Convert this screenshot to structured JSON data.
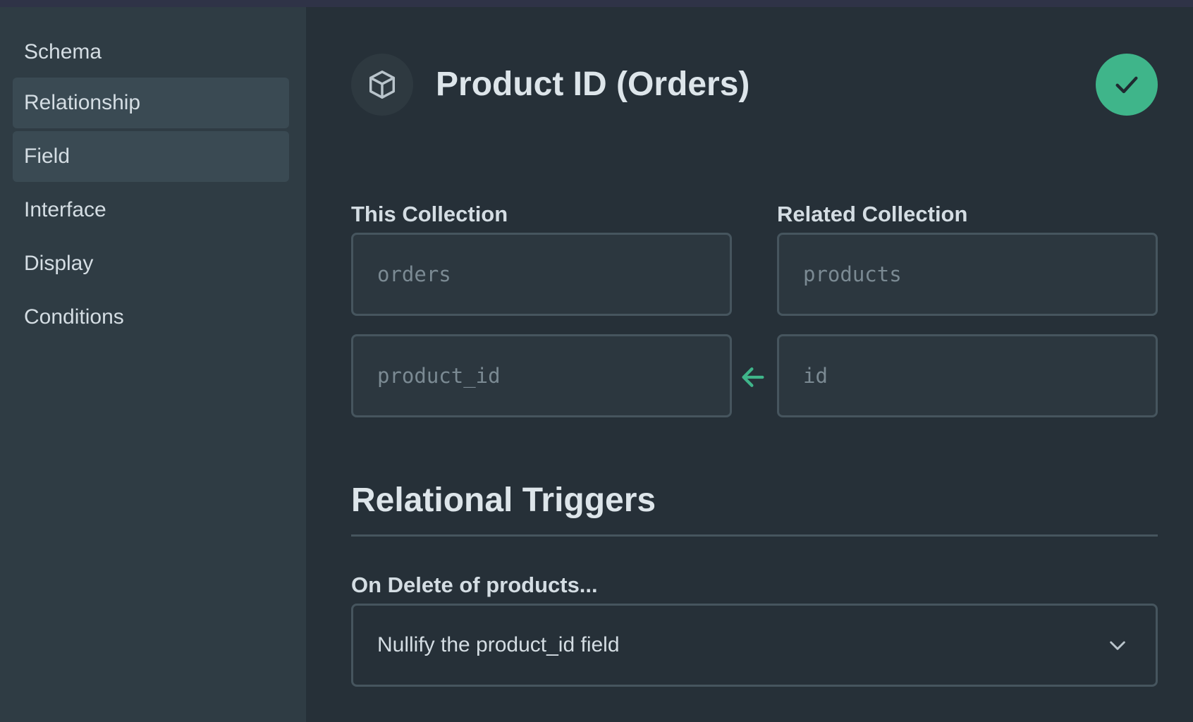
{
  "sidebar": {
    "items": [
      {
        "label": "Schema",
        "active": false
      },
      {
        "label": "Relationship",
        "active": true
      },
      {
        "label": "Field",
        "active": true
      },
      {
        "label": "Interface",
        "active": false
      },
      {
        "label": "Display",
        "active": false
      },
      {
        "label": "Conditions",
        "active": false
      }
    ]
  },
  "header": {
    "title": "Product ID (Orders)",
    "icon": "cube-icon",
    "save_icon": "check-icon"
  },
  "relationship": {
    "this_collection_label": "This Collection",
    "related_collection_label": "Related Collection",
    "this_collection_value": "orders",
    "related_collection_value": "products",
    "this_field_value": "product_id",
    "related_field_value": "id",
    "arrow_icon": "arrow-left-icon"
  },
  "triggers": {
    "section_title": "Relational Triggers",
    "on_delete_label": "On Delete of products...",
    "on_delete_value": "Nullify the product_id field"
  },
  "colors": {
    "accent": "#3fb58a",
    "sidebar_bg": "#2f3c44",
    "main_bg": "#263038"
  }
}
